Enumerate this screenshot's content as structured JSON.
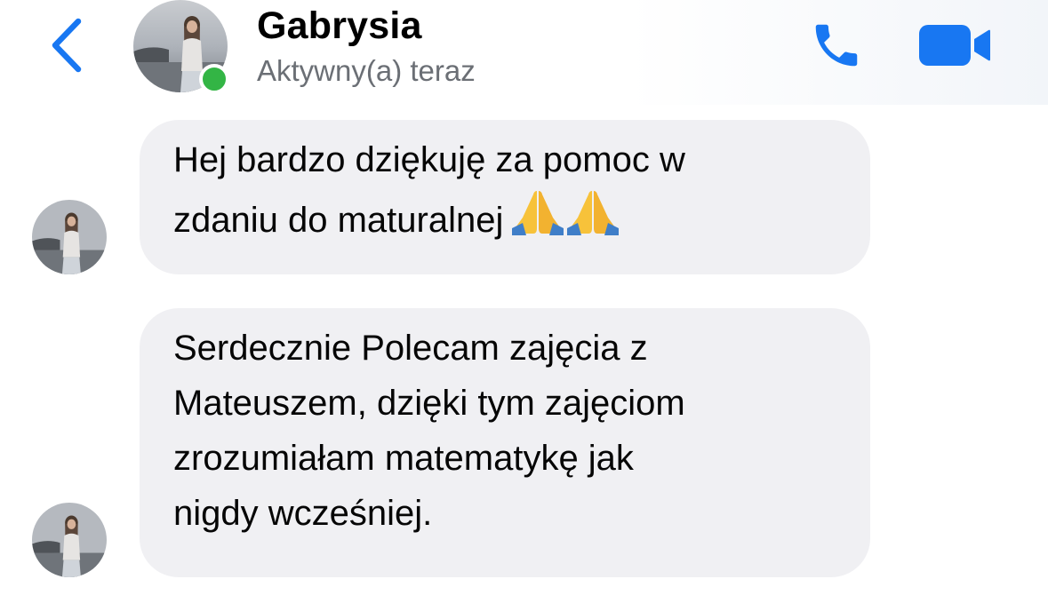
{
  "header": {
    "contact_name": "Gabrysia",
    "status": "Aktywny(a) teraz",
    "online": true,
    "back_icon": "chevron-left-icon",
    "call_icon": "phone-icon",
    "video_icon": "video-camera-icon",
    "accent_color": "#1877f2"
  },
  "messages": [
    {
      "lines": [
        "Hej bardzo dziękuję za pomoc w",
        "zdaniu do maturalnej"
      ],
      "emoji": "🙏🙏",
      "emoji_icon": "folded-hands-emoji"
    },
    {
      "lines": [
        "Serdecznie Polecam zajęcia z",
        "Mateuszem, dzięki tym zajęciom",
        "zrozumiałam matematykę jak",
        "nigdy wcześniej."
      ]
    }
  ],
  "colors": {
    "bubble_bg": "#f0f0f3",
    "online_dot": "#33b545"
  }
}
